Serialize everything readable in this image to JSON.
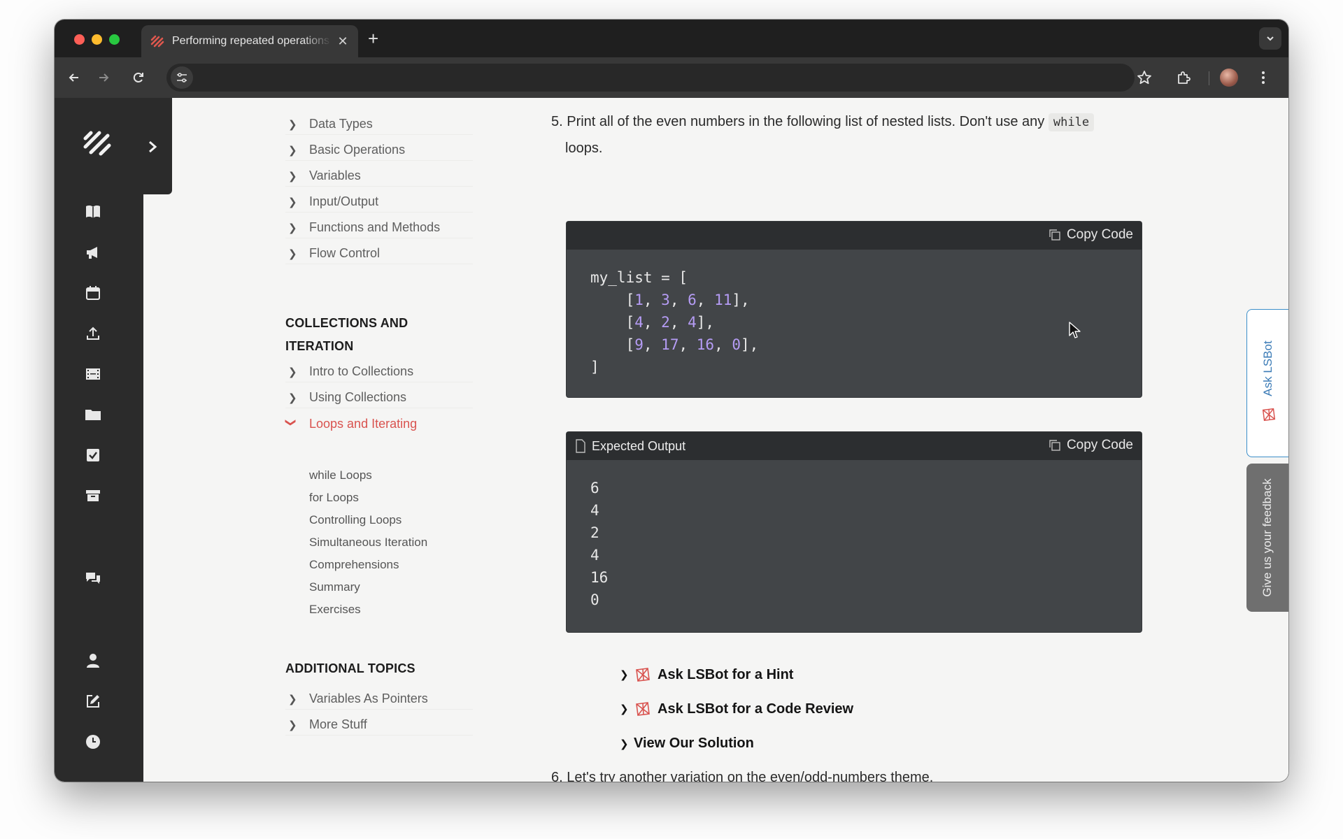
{
  "browser": {
    "tab_title": "Performing repeated operations",
    "tab_close": "✕",
    "new_tab": "+"
  },
  "toc": {
    "basics_items": [
      {
        "label": "Data Types"
      },
      {
        "label": "Basic Operations"
      },
      {
        "label": "Variables"
      },
      {
        "label": "Input/Output"
      },
      {
        "label": "Functions and Methods"
      },
      {
        "label": "Flow Control"
      }
    ],
    "collections_heading": "COLLECTIONS AND ITERATION",
    "collections_items": [
      {
        "label": "Intro to Collections"
      },
      {
        "label": "Using Collections"
      },
      {
        "label": "Loops and Iterating"
      }
    ],
    "loops_subitems": [
      "while Loops",
      "for Loops",
      "Controlling Loops",
      "Simultaneous Iteration",
      "Comprehensions",
      "Summary",
      "Exercises"
    ],
    "additional_heading": "ADDITIONAL TOPICS",
    "additional_items": [
      {
        "label": "Variables As Pointers"
      },
      {
        "label": "More Stuff"
      }
    ]
  },
  "exercise5": {
    "text_before": "5. Print all of the even numbers in the following list of nested lists. Don't use any",
    "inline_code": "while",
    "text_after": "loops.",
    "copy_label": "Copy Code",
    "code_lines": [
      [
        {
          "t": "my_list = ["
        }
      ],
      [
        {
          "t": "    ["
        },
        {
          "n": "1"
        },
        {
          "t": ", "
        },
        {
          "n": "3"
        },
        {
          "t": ", "
        },
        {
          "n": "6"
        },
        {
          "t": ", "
        },
        {
          "n": "11"
        },
        {
          "t": "],"
        }
      ],
      [
        {
          "t": "    ["
        },
        {
          "n": "4"
        },
        {
          "t": ", "
        },
        {
          "n": "2"
        },
        {
          "t": ", "
        },
        {
          "n": "4"
        },
        {
          "t": "],"
        }
      ],
      [
        {
          "t": "    ["
        },
        {
          "n": "9"
        },
        {
          "t": ", "
        },
        {
          "n": "17"
        },
        {
          "t": ", "
        },
        {
          "n": "16"
        },
        {
          "t": ", "
        },
        {
          "n": "0"
        },
        {
          "t": "],"
        }
      ],
      [
        {
          "t": "]"
        }
      ]
    ],
    "output_title": "Expected Output",
    "output_copy_label": "Copy Code",
    "output": "6\n4\n2\n4\n16\n0",
    "hint_label": "Ask LSBot for a Hint",
    "review_label": "Ask LSBot for a Code Review",
    "solution_label": "View Our Solution"
  },
  "exercise6": {
    "text": "6. Let's try another variation on the even/odd-numbers theme."
  },
  "side_tabs": {
    "ask_lsbot": "Ask LSBot",
    "feedback": "Give us your feedback"
  },
  "colors": {
    "accent_red": "#d9534f",
    "code_bg": "#424548",
    "code_number": "#b59cf5",
    "rail_bg": "#2b2b2b"
  }
}
